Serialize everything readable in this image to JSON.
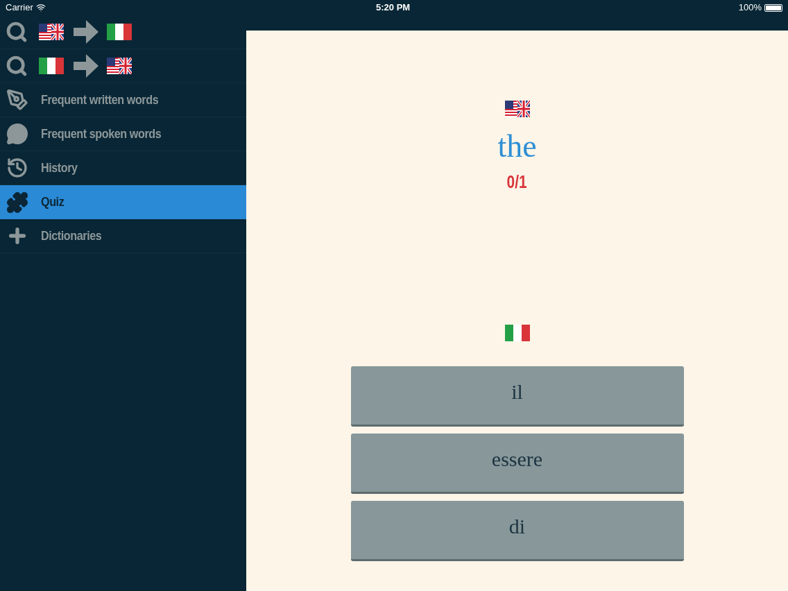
{
  "status_bar": {
    "carrier": "Carrier",
    "time": "5:20 PM",
    "battery": "100%"
  },
  "sidebar": {
    "search_rows": [
      {
        "kind": "forward",
        "selected": false
      },
      {
        "kind": "reverse",
        "selected": false
      }
    ],
    "items": [
      {
        "label": "Frequent written words",
        "selected": false
      },
      {
        "label": "Frequent spoken words",
        "selected": false
      },
      {
        "label": "History",
        "selected": false
      },
      {
        "label": "Quiz",
        "selected": true
      },
      {
        "label": "Dictionaries",
        "selected": false
      }
    ]
  },
  "quiz": {
    "word": "the",
    "score": "0/1",
    "options": [
      "il",
      "essere",
      "di"
    ]
  }
}
